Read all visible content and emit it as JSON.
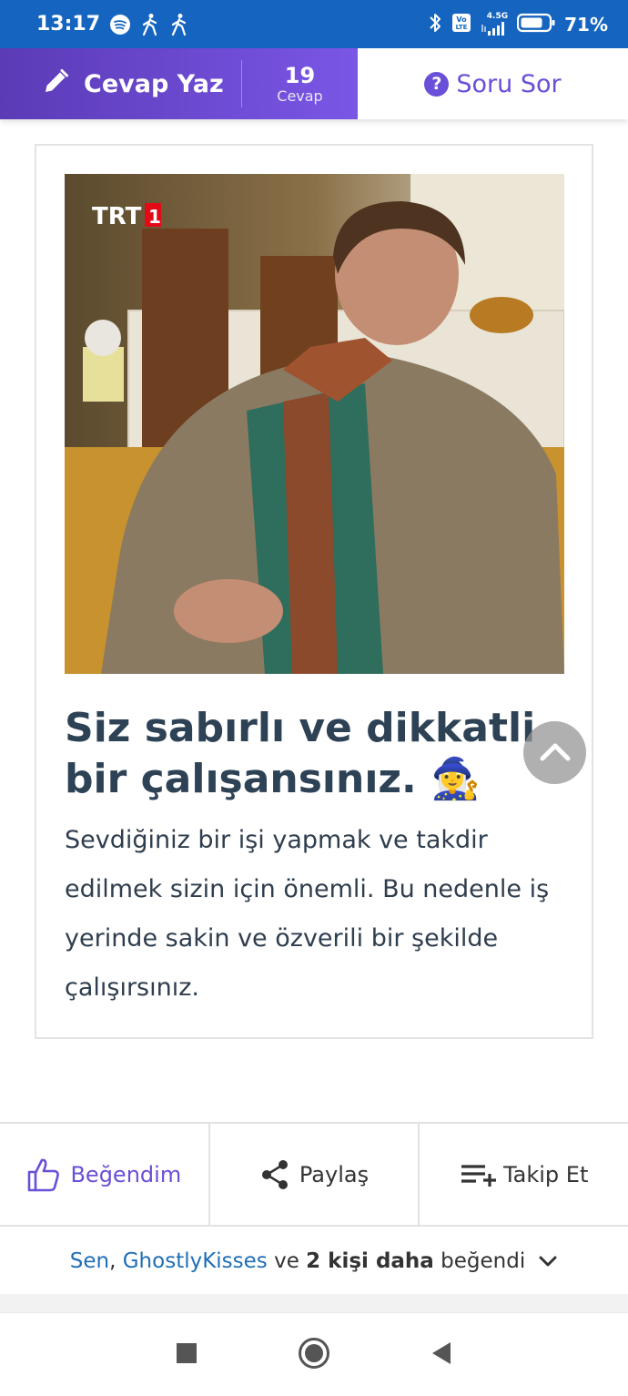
{
  "status_bar": {
    "time": "13:17",
    "network": "4.5G",
    "volte": "Vo LTE",
    "battery": "71%"
  },
  "header": {
    "answer_label": "Cevap Yaz",
    "answer_count": "19",
    "answer_count_label": "Cevap",
    "ask_label": "Soru Sor"
  },
  "card": {
    "image_watermark": "TRT1",
    "title": "Siz sabırlı ve dikkatli bir çalışansınız. 🧙‍♀️",
    "description": "Sevdiğiniz bir işi yapmak ve takdir edilmek sizin için önemli. Bu nedenle iş yerinde sakin ve özverili bir şekilde çalışırsınız."
  },
  "actions": {
    "like_label": "Beğendim",
    "share_label": "Paylaş",
    "follow_label": "Takip Et"
  },
  "likes": {
    "user1": "Sen",
    "sep": ",",
    "user2": "GhostlyKisses",
    "and": "ve",
    "count_text": "2 kişi daha",
    "suffix": "beğendi"
  },
  "colors": {
    "status_bar": "#1565c0",
    "accent": "#6a4fd8",
    "title": "#2e4256",
    "link": "#1f6fb7"
  }
}
